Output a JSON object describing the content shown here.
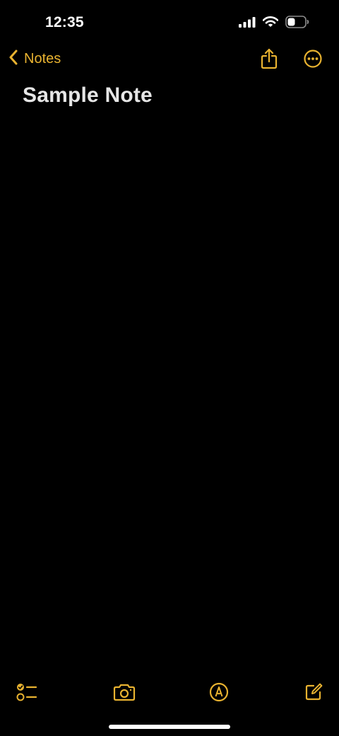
{
  "status_bar": {
    "time": "12:35",
    "icons": [
      "cellular-signal-icon",
      "wifi-icon",
      "battery-icon"
    ]
  },
  "nav": {
    "back_label": "Notes",
    "back_icon": "chevron-left-icon",
    "share_icon": "share-icon",
    "more_icon": "more-options-icon"
  },
  "note": {
    "title": "Sample Note",
    "body": ""
  },
  "toolbar": {
    "items": [
      "checklist-icon",
      "camera-icon",
      "markup-icon",
      "compose-icon"
    ]
  },
  "colors": {
    "accent": "#e8b230",
    "background": "#000000",
    "title_text": "#e6e6e6",
    "status_text": "#ffffff"
  }
}
